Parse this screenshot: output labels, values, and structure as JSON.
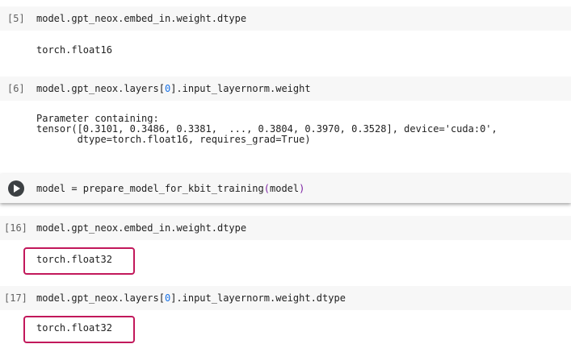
{
  "colors": {
    "cell_bg": "#f7f7f7",
    "highlight_border": "#c2185b",
    "number_blue": "#1a73e8",
    "paren_purple": "#7b1fa2"
  },
  "cells": [
    {
      "prompt": "[5]",
      "code": "model.gpt_neox.embed_in.weight.dtype",
      "output": [
        "torch.float16"
      ]
    },
    {
      "prompt": "[6]",
      "code_pre": "model.gpt_neox.layers[",
      "code_num": "0",
      "code_post": "].input_layernorm.weight",
      "output": [
        "Parameter containing:",
        "tensor([0.3101, 0.3486, 0.3381,  ..., 0.3804, 0.3970, 0.3528], device='cuda:0',",
        "       dtype=torch.float16, requires_grad=True)"
      ]
    },
    {
      "run_icon": "play-icon",
      "code_pre": "model = prepare_model_for_kbit_training",
      "code_paren_open": "(",
      "code_arg": "model",
      "code_paren_close": ")"
    },
    {
      "prompt": "[16]",
      "code": "model.gpt_neox.embed_in.weight.dtype",
      "output": [
        "torch.float32"
      ]
    },
    {
      "prompt": "[17]",
      "code_pre": "model.gpt_neox.layers[",
      "code_num": "0",
      "code_post": "].input_layernorm.weight.dtype",
      "output": [
        "torch.float32"
      ]
    }
  ]
}
